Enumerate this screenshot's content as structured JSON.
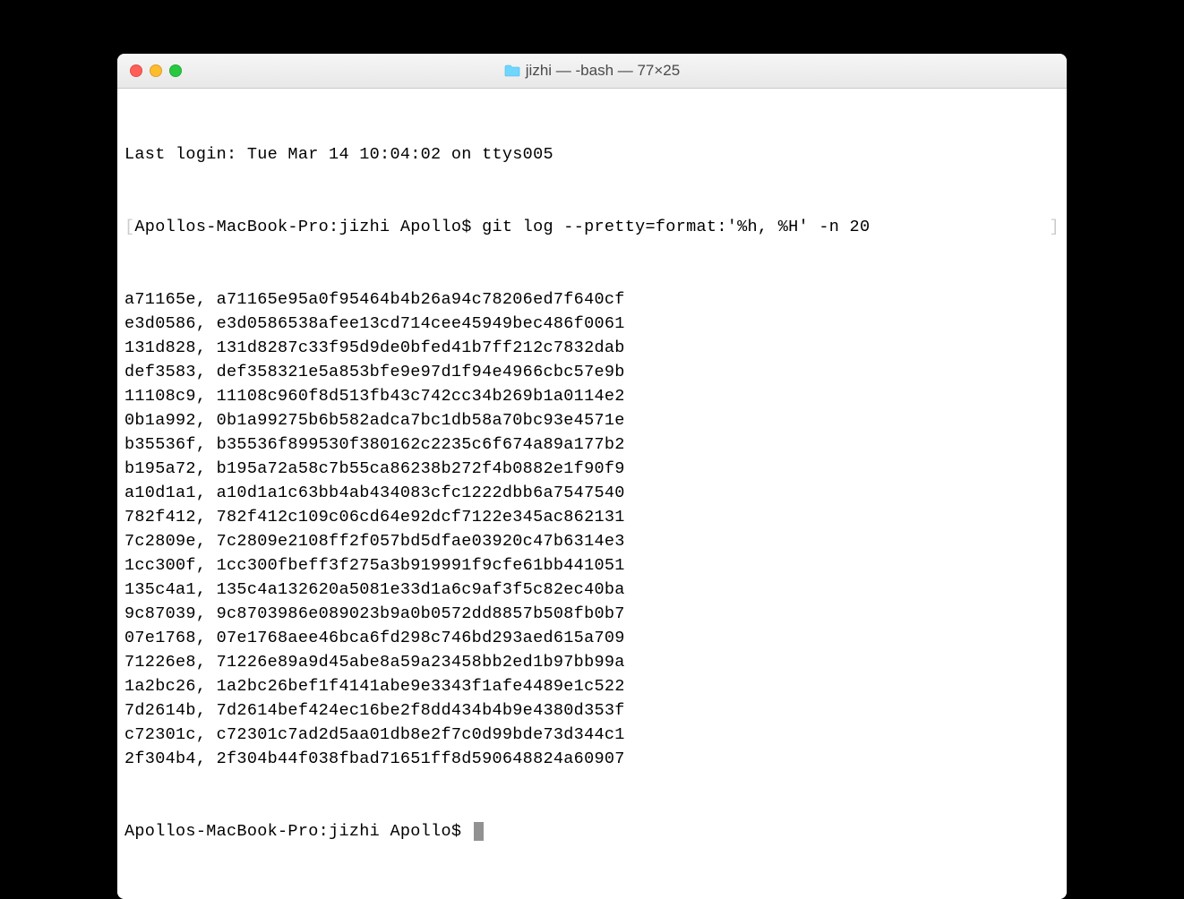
{
  "window": {
    "title": "jizhi — -bash — 77×25"
  },
  "session": {
    "last_login": "Last login: Tue Mar 14 10:04:02 on ttys005",
    "prompt": "Apollos-MacBook-Pro:jizhi Apollo$ ",
    "command": "git log --pretty=format:'%h, %H' -n 20",
    "left_bracket": "[",
    "right_bracket": "]"
  },
  "commits": [
    {
      "short": "a71165e",
      "full": "a71165e95a0f95464b4b26a94c78206ed7f640cf"
    },
    {
      "short": "e3d0586",
      "full": "e3d0586538afee13cd714cee45949bec486f0061"
    },
    {
      "short": "131d828",
      "full": "131d8287c33f95d9de0bfed41b7ff212c7832dab"
    },
    {
      "short": "def3583",
      "full": "def358321e5a853bfe9e97d1f94e4966cbc57e9b"
    },
    {
      "short": "11108c9",
      "full": "11108c960f8d513fb43c742cc34b269b1a0114e2"
    },
    {
      "short": "0b1a992",
      "full": "0b1a99275b6b582adca7bc1db58a70bc93e4571e"
    },
    {
      "short": "b35536f",
      "full": "b35536f899530f380162c2235c6f674a89a177b2"
    },
    {
      "short": "b195a72",
      "full": "b195a72a58c7b55ca86238b272f4b0882e1f90f9"
    },
    {
      "short": "a10d1a1",
      "full": "a10d1a1c63bb4ab434083cfc1222dbb6a7547540"
    },
    {
      "short": "782f412",
      "full": "782f412c109c06cd64e92dcf7122e345ac862131"
    },
    {
      "short": "7c2809e",
      "full": "7c2809e2108ff2f057bd5dfae03920c47b6314e3"
    },
    {
      "short": "1cc300f",
      "full": "1cc300fbeff3f275a3b919991f9cfe61bb441051"
    },
    {
      "short": "135c4a1",
      "full": "135c4a132620a5081e33d1a6c9af3f5c82ec40ba"
    },
    {
      "short": "9c87039",
      "full": "9c8703986e089023b9a0b0572dd8857b508fb0b7"
    },
    {
      "short": "07e1768",
      "full": "07e1768aee46bca6fd298c746bd293aed615a709"
    },
    {
      "short": "71226e8",
      "full": "71226e89a9d45abe8a59a23458bb2ed1b97bb99a"
    },
    {
      "short": "1a2bc26",
      "full": "1a2bc26bef1f4141abe9e3343f1afe4489e1c522"
    },
    {
      "short": "7d2614b",
      "full": "7d2614bef424ec16be2f8dd434b4b9e4380d353f"
    },
    {
      "short": "c72301c",
      "full": "c72301c7ad2d5aa01db8e2f7c0d99bde73d344c1"
    },
    {
      "short": "2f304b4",
      "full": "2f304b44f038fbad71651ff8d590648824a60907"
    }
  ]
}
